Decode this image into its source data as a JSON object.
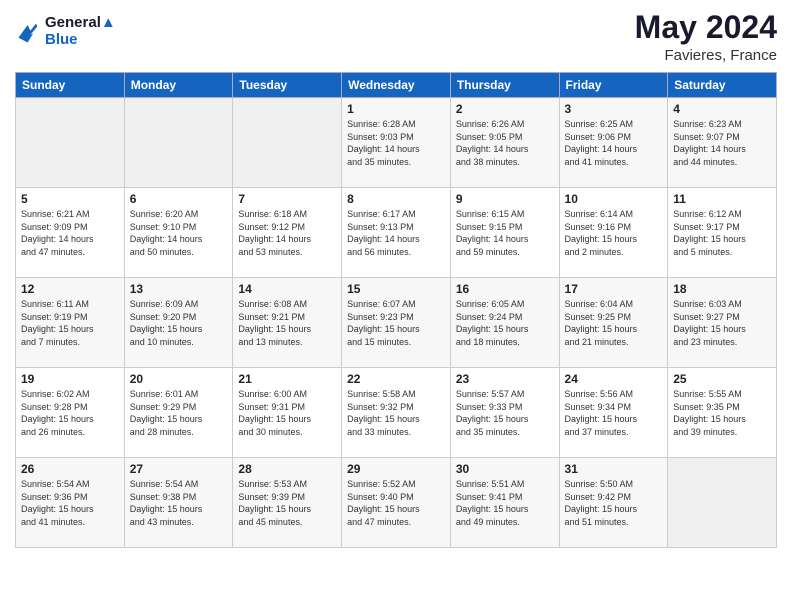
{
  "header": {
    "logo_line1": "General",
    "logo_line2": "Blue",
    "title": "May 2024",
    "subtitle": "Favieres, France"
  },
  "days_of_week": [
    "Sunday",
    "Monday",
    "Tuesday",
    "Wednesday",
    "Thursday",
    "Friday",
    "Saturday"
  ],
  "weeks": [
    [
      {
        "num": "",
        "info": ""
      },
      {
        "num": "",
        "info": ""
      },
      {
        "num": "",
        "info": ""
      },
      {
        "num": "1",
        "info": "Sunrise: 6:28 AM\nSunset: 9:03 PM\nDaylight: 14 hours\nand 35 minutes."
      },
      {
        "num": "2",
        "info": "Sunrise: 6:26 AM\nSunset: 9:05 PM\nDaylight: 14 hours\nand 38 minutes."
      },
      {
        "num": "3",
        "info": "Sunrise: 6:25 AM\nSunset: 9:06 PM\nDaylight: 14 hours\nand 41 minutes."
      },
      {
        "num": "4",
        "info": "Sunrise: 6:23 AM\nSunset: 9:07 PM\nDaylight: 14 hours\nand 44 minutes."
      }
    ],
    [
      {
        "num": "5",
        "info": "Sunrise: 6:21 AM\nSunset: 9:09 PM\nDaylight: 14 hours\nand 47 minutes."
      },
      {
        "num": "6",
        "info": "Sunrise: 6:20 AM\nSunset: 9:10 PM\nDaylight: 14 hours\nand 50 minutes."
      },
      {
        "num": "7",
        "info": "Sunrise: 6:18 AM\nSunset: 9:12 PM\nDaylight: 14 hours\nand 53 minutes."
      },
      {
        "num": "8",
        "info": "Sunrise: 6:17 AM\nSunset: 9:13 PM\nDaylight: 14 hours\nand 56 minutes."
      },
      {
        "num": "9",
        "info": "Sunrise: 6:15 AM\nSunset: 9:15 PM\nDaylight: 14 hours\nand 59 minutes."
      },
      {
        "num": "10",
        "info": "Sunrise: 6:14 AM\nSunset: 9:16 PM\nDaylight: 15 hours\nand 2 minutes."
      },
      {
        "num": "11",
        "info": "Sunrise: 6:12 AM\nSunset: 9:17 PM\nDaylight: 15 hours\nand 5 minutes."
      }
    ],
    [
      {
        "num": "12",
        "info": "Sunrise: 6:11 AM\nSunset: 9:19 PM\nDaylight: 15 hours\nand 7 minutes."
      },
      {
        "num": "13",
        "info": "Sunrise: 6:09 AM\nSunset: 9:20 PM\nDaylight: 15 hours\nand 10 minutes."
      },
      {
        "num": "14",
        "info": "Sunrise: 6:08 AM\nSunset: 9:21 PM\nDaylight: 15 hours\nand 13 minutes."
      },
      {
        "num": "15",
        "info": "Sunrise: 6:07 AM\nSunset: 9:23 PM\nDaylight: 15 hours\nand 15 minutes."
      },
      {
        "num": "16",
        "info": "Sunrise: 6:05 AM\nSunset: 9:24 PM\nDaylight: 15 hours\nand 18 minutes."
      },
      {
        "num": "17",
        "info": "Sunrise: 6:04 AM\nSunset: 9:25 PM\nDaylight: 15 hours\nand 21 minutes."
      },
      {
        "num": "18",
        "info": "Sunrise: 6:03 AM\nSunset: 9:27 PM\nDaylight: 15 hours\nand 23 minutes."
      }
    ],
    [
      {
        "num": "19",
        "info": "Sunrise: 6:02 AM\nSunset: 9:28 PM\nDaylight: 15 hours\nand 26 minutes."
      },
      {
        "num": "20",
        "info": "Sunrise: 6:01 AM\nSunset: 9:29 PM\nDaylight: 15 hours\nand 28 minutes."
      },
      {
        "num": "21",
        "info": "Sunrise: 6:00 AM\nSunset: 9:31 PM\nDaylight: 15 hours\nand 30 minutes."
      },
      {
        "num": "22",
        "info": "Sunrise: 5:58 AM\nSunset: 9:32 PM\nDaylight: 15 hours\nand 33 minutes."
      },
      {
        "num": "23",
        "info": "Sunrise: 5:57 AM\nSunset: 9:33 PM\nDaylight: 15 hours\nand 35 minutes."
      },
      {
        "num": "24",
        "info": "Sunrise: 5:56 AM\nSunset: 9:34 PM\nDaylight: 15 hours\nand 37 minutes."
      },
      {
        "num": "25",
        "info": "Sunrise: 5:55 AM\nSunset: 9:35 PM\nDaylight: 15 hours\nand 39 minutes."
      }
    ],
    [
      {
        "num": "26",
        "info": "Sunrise: 5:54 AM\nSunset: 9:36 PM\nDaylight: 15 hours\nand 41 minutes."
      },
      {
        "num": "27",
        "info": "Sunrise: 5:54 AM\nSunset: 9:38 PM\nDaylight: 15 hours\nand 43 minutes."
      },
      {
        "num": "28",
        "info": "Sunrise: 5:53 AM\nSunset: 9:39 PM\nDaylight: 15 hours\nand 45 minutes."
      },
      {
        "num": "29",
        "info": "Sunrise: 5:52 AM\nSunset: 9:40 PM\nDaylight: 15 hours\nand 47 minutes."
      },
      {
        "num": "30",
        "info": "Sunrise: 5:51 AM\nSunset: 9:41 PM\nDaylight: 15 hours\nand 49 minutes."
      },
      {
        "num": "31",
        "info": "Sunrise: 5:50 AM\nSunset: 9:42 PM\nDaylight: 15 hours\nand 51 minutes."
      },
      {
        "num": "",
        "info": ""
      }
    ]
  ]
}
